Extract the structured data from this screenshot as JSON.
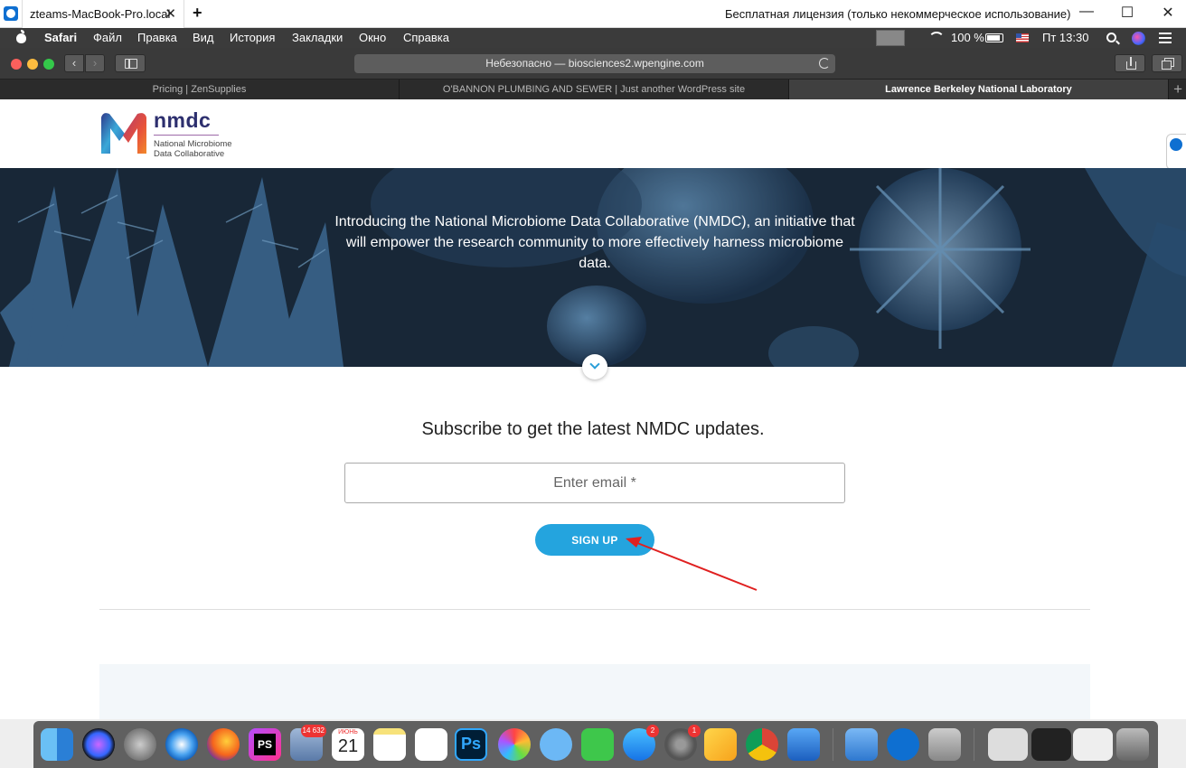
{
  "teamviewer": {
    "tab_title": "zteams-MacBook-Pro.local",
    "close_glyph": "✕",
    "add_glyph": "+",
    "license_text": "Бесплатная лицензия (только некоммерческое использование)",
    "minimize_glyph": "—",
    "maximize_glyph": "☐",
    "close_window_glyph": "✕"
  },
  "mac_menu": {
    "app": "Safari",
    "items": [
      "Файл",
      "Правка",
      "Вид",
      "История",
      "Закладки",
      "Окно",
      "Справка"
    ],
    "battery": "100 %",
    "clock": "Пт 13:30"
  },
  "safari": {
    "back_glyph": "‹",
    "forward_glyph": "›",
    "address": "Небезопасно — biosciences2.wpengine.com",
    "tabs": [
      {
        "label": "Pricing | ZenSupplies"
      },
      {
        "label": "O'BANNON PLUMBING AND SEWER | Just another WordPress site"
      },
      {
        "label": "Lawrence Berkeley National Laboratory"
      }
    ],
    "new_tab_glyph": "+"
  },
  "page": {
    "logo": {
      "title": "nmdc",
      "sub_line1": "National Microbiome",
      "sub_line2": "Data Collaborative"
    },
    "hero_text": "Introducing the National Microbiome Data Collaborative (NMDC), an initiative that will empower the research community to more effectively harness microbiome data.",
    "subscribe_heading": "Subscribe to get the latest NMDC updates.",
    "email_placeholder": "Enter email *",
    "signup_label": "SIGN UP"
  },
  "dock": {
    "badges": {
      "photos": "14 632",
      "appstore": "2",
      "prefs": "1"
    },
    "calendar_month": "ИЮНЬ",
    "calendar_day": "21",
    "ps_label": "Ps",
    "phpstorm_label": "PS"
  },
  "colors": {
    "signup": "#24a4de",
    "menu_bar": "#3b3b3b",
    "hero_bg": "#1c2c3d",
    "annotation_arrow": "#e02020"
  }
}
